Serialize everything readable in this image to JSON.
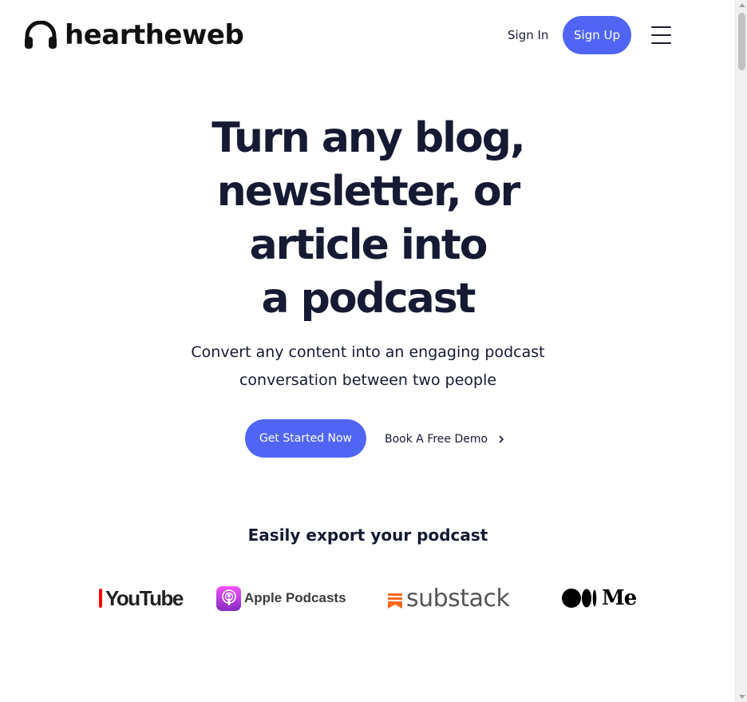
{
  "header": {
    "logo_text": "heartheweb",
    "sign_in_label": "Sign In",
    "sign_up_label": "Sign Up"
  },
  "hero": {
    "title_lines": [
      "Turn any blog,",
      "newsletter, or",
      "article into",
      "a podcast"
    ],
    "subtitle": "Convert any content into an engaging podcast conversation between two people",
    "primary_cta": "Get Started Now",
    "secondary_cta": "Book A Free Demo"
  },
  "export": {
    "title": "Easily export your podcast",
    "logos": [
      {
        "name": "YouTube",
        "text": "YouTube",
        "icon": "youtube-icon"
      },
      {
        "name": "Apple Podcasts",
        "text": "Apple Podcasts",
        "icon": "apple-podcasts-icon"
      },
      {
        "name": "substack",
        "text": "substack",
        "icon": "substack-icon"
      },
      {
        "name": "Medium",
        "text": "Med",
        "icon": "medium-icon"
      }
    ]
  },
  "colors": {
    "accent": "#5165f5",
    "text": "#161a33",
    "background": "#ffffff"
  }
}
